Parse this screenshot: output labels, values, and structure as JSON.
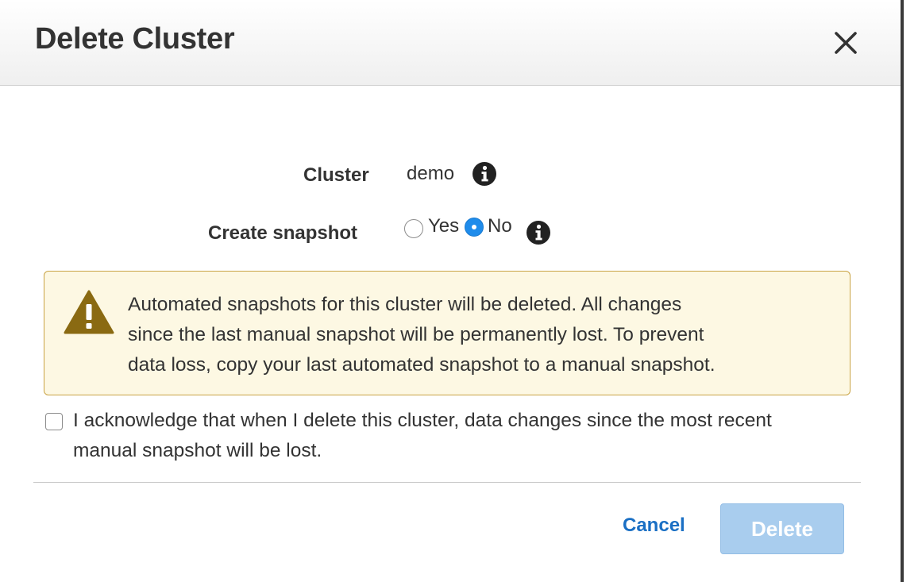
{
  "dialog": {
    "title": "Delete Cluster",
    "close_icon": "close-icon"
  },
  "form": {
    "cluster_label": "Cluster",
    "cluster_value": "demo",
    "snapshot_label": "Create snapshot",
    "snapshot_options": [
      {
        "label": "Yes",
        "selected": false
      },
      {
        "label": "No",
        "selected": true
      }
    ],
    "info_icon": "info-icon"
  },
  "warning": {
    "icon": "warning-icon",
    "lines": [
      "Automated snapshots for this cluster will be deleted. All changes",
      "since the last manual snapshot will be permanently lost. To prevent",
      "data loss, copy your last automated snapshot to a manual snapshot."
    ]
  },
  "acknowledge": {
    "checked": false,
    "lines": [
      "I acknowledge that when I delete this cluster, data changes since the most recent",
      "manual snapshot will be lost."
    ]
  },
  "footer": {
    "cancel_label": "Cancel",
    "delete_label": "Delete",
    "delete_enabled": false
  },
  "colors": {
    "accent": "#1f8ceb",
    "link": "#1a6fc4",
    "delete_disabled": "#a9cdee",
    "warning_bg": "#fdf8e3",
    "warning_border": "#c9a344",
    "warning_icon": "#8a6a12"
  }
}
